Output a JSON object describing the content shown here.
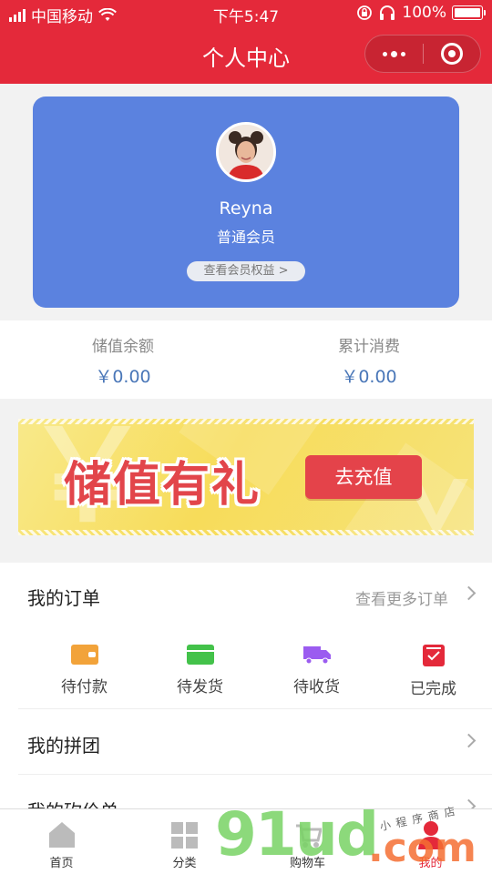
{
  "status_bar": {
    "carrier": "中国移动",
    "time": "下午5:47",
    "battery": "100%",
    "icons": [
      "signal-icon",
      "wifi-icon",
      "screen-rotation-lock-icon",
      "headphones-icon",
      "battery-icon"
    ]
  },
  "navbar": {
    "title": "个人中心",
    "more_icon": "more-dots-icon",
    "close_icon": "mini-program-close-icon"
  },
  "profile": {
    "username": "Reyna",
    "member_level": "普通会员",
    "benefits_label": "查看会员权益 >"
  },
  "balance": {
    "stored_label": "储值余额",
    "stored_value": "￥0.00",
    "spent_label": "累计消费",
    "spent_value": "￥0.00"
  },
  "banner": {
    "title": "储值有礼",
    "button": "去充值",
    "bg_glyph": "￥"
  },
  "orders": {
    "title": "我的订单",
    "more": "查看更多订单",
    "statuses": [
      {
        "label": "待付款",
        "icon": "wallet-icon",
        "color": "#f2a33a"
      },
      {
        "label": "待发货",
        "icon": "package-icon",
        "color": "#43c24a"
      },
      {
        "label": "待收货",
        "icon": "truck-icon",
        "color": "#9b5cf0"
      },
      {
        "label": "已完成",
        "icon": "completed-checklist-icon",
        "color": "#e4293a"
      }
    ]
  },
  "group_buy": {
    "title": "我的拼团"
  },
  "bargain": {
    "title": "我的砍价单"
  },
  "tabbar": {
    "items": [
      {
        "label": "首页",
        "icon": "home-icon"
      },
      {
        "label": "分类",
        "icon": "category-grid-icon"
      },
      {
        "label": "购物车",
        "icon": "cart-icon"
      },
      {
        "label": "我的",
        "icon": "user-icon",
        "active": true
      }
    ],
    "active_color": "#e4293a"
  },
  "watermark": {
    "site": "91ud",
    "tld": ".com",
    "handwriting": "小程序商店"
  },
  "colors": {
    "brand_red": "#e4293a",
    "card_blue": "#5b82df",
    "amount_blue": "#4a77b8"
  }
}
